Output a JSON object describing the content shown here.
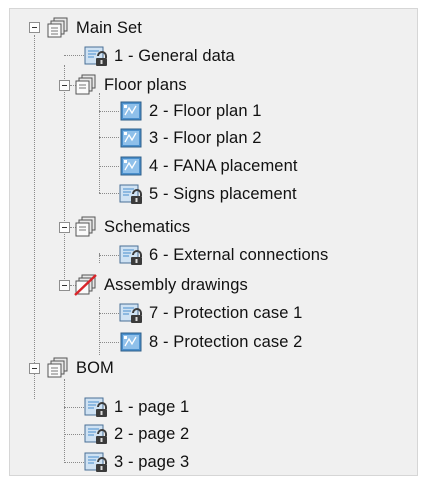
{
  "tree": {
    "root": {
      "label": "Main Set",
      "icon": "sheet-set-icon"
    },
    "general": {
      "label": "1 - General data",
      "icon": "locked-sheet-icon"
    },
    "floor_plans": {
      "label": "Floor plans",
      "icon": "subset-icon"
    },
    "fp1": {
      "label": "2 - Floor plan 1",
      "icon": "sheet-icon"
    },
    "fp2": {
      "label": "3 - Floor plan 2",
      "icon": "sheet-icon"
    },
    "fana": {
      "label": "4 - FANA placement",
      "icon": "sheet-icon"
    },
    "signs": {
      "label": "5 - Signs placement",
      "icon": "locked-sheet-icon"
    },
    "schematics": {
      "label": "Schematics",
      "icon": "subset-icon"
    },
    "ext": {
      "label": "6 - External connections",
      "icon": "locked-sheet-icon"
    },
    "assembly": {
      "label": "Assembly drawings",
      "icon": "excluded-subset-icon"
    },
    "pc1": {
      "label": "7 - Protection case 1",
      "icon": "locked-sheet-icon"
    },
    "pc2": {
      "label": "8 - Protection case 2",
      "icon": "sheet-icon"
    },
    "bom": {
      "label": "BOM",
      "icon": "sheet-set-icon"
    },
    "p1": {
      "label": "1 - page 1",
      "icon": "locked-sheet-icon"
    },
    "p2": {
      "label": "2 - page 2",
      "icon": "locked-sheet-icon"
    },
    "p3": {
      "label": "3 - page 3",
      "icon": "locked-sheet-icon"
    }
  },
  "colors": {
    "panel_bg": "#f0f0f0",
    "sheet_blue": "#4a8fcc",
    "lock_dark": "#3b3b3b",
    "excluded_red": "#d9252a"
  }
}
